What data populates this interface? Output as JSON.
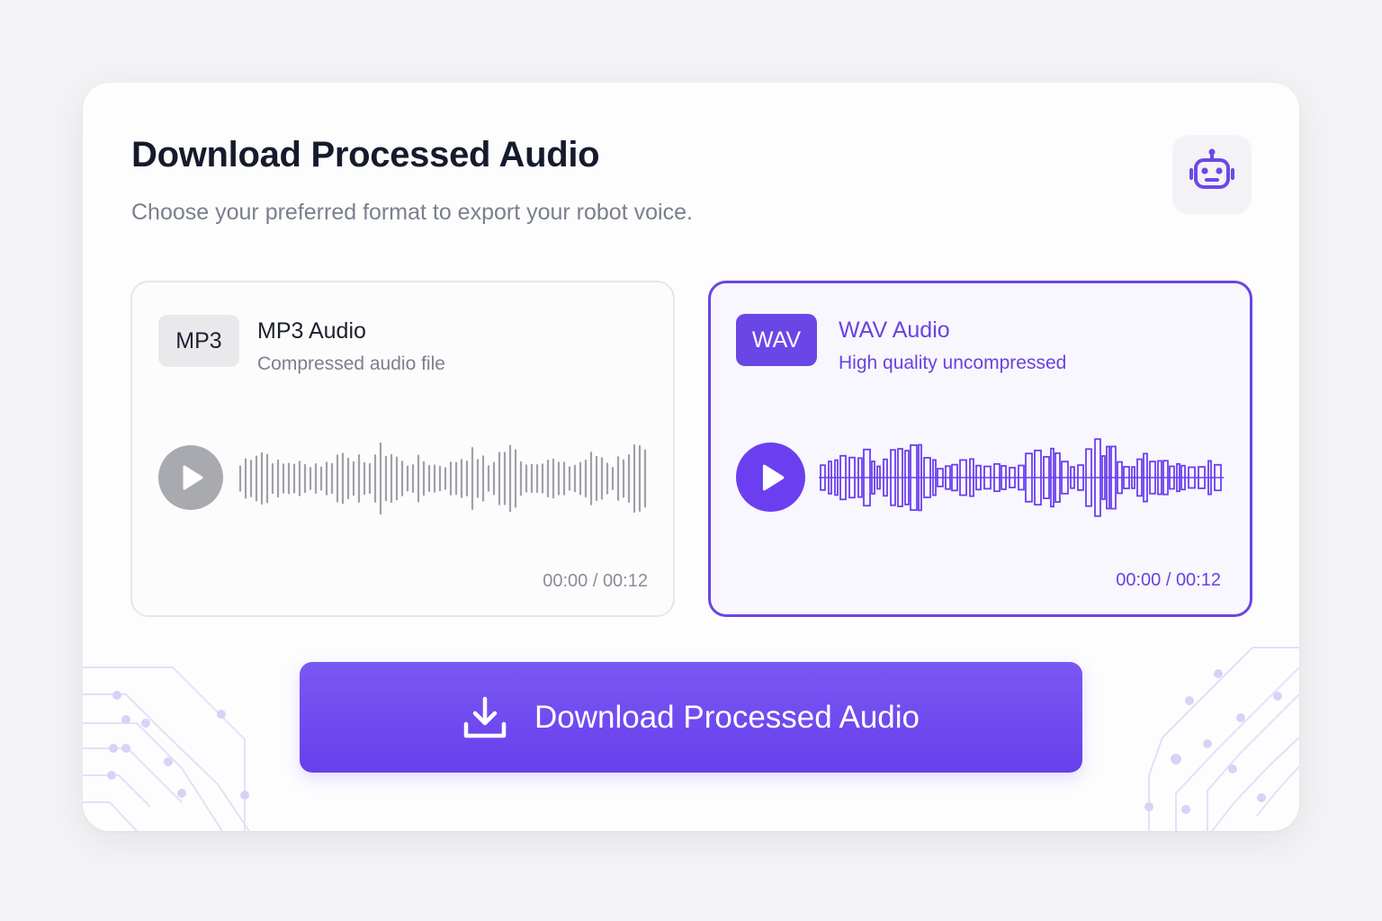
{
  "header": {
    "title": "Download Processed Audio",
    "subtitle": "Choose your preferred format to export your robot voice."
  },
  "icons": {
    "header": "robot-icon",
    "play": "play-icon",
    "download": "download-icon"
  },
  "formats": [
    {
      "badge": "MP3",
      "name": "MP3 Audio",
      "description": "Compressed audio file",
      "time": "00:00 / 00:12",
      "selected": false,
      "accent": "#a8aab0"
    },
    {
      "badge": "WAV",
      "name": "WAV Audio",
      "description": "High quality uncompressed",
      "time": "00:00 / 00:12",
      "selected": true,
      "accent": "#6b3ff0"
    }
  ],
  "download_button": {
    "label": "Download Processed Audio"
  },
  "colors": {
    "accent": "#6b46e6",
    "button": "#6e47ee",
    "title": "#161a2c",
    "muted": "#7a7f8c"
  }
}
